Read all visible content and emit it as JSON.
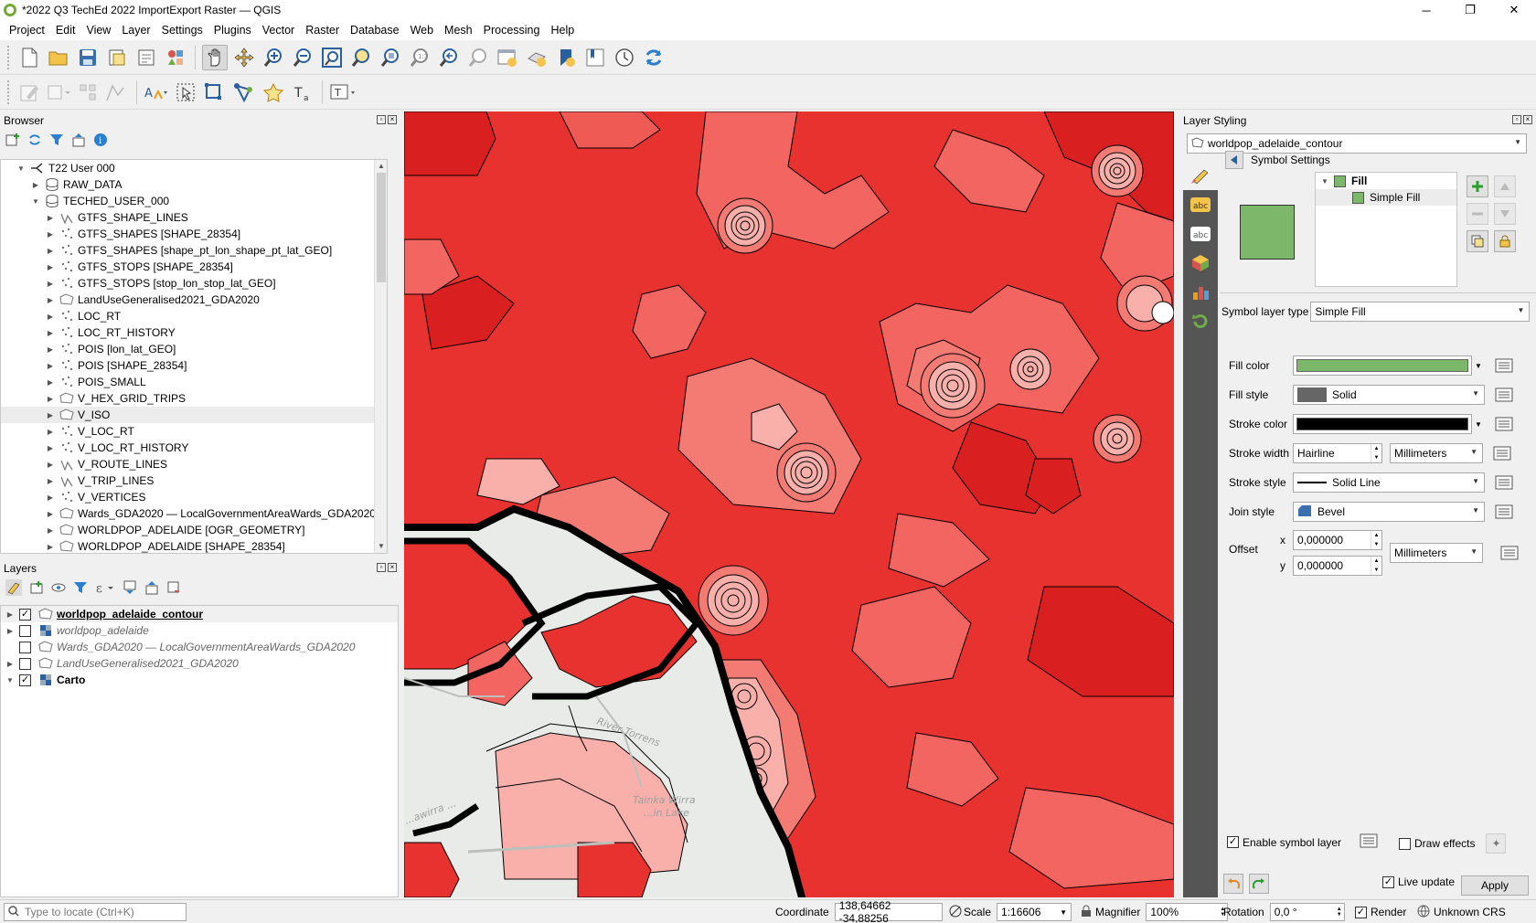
{
  "window": {
    "title": "*2022 Q3 TechEd 2022 ImportExport Raster — QGIS",
    "controls": [
      "─",
      "❐",
      "✕"
    ]
  },
  "menu": [
    "Project",
    "Edit",
    "View",
    "Layer",
    "Settings",
    "Plugins",
    "Vector",
    "Raster",
    "Database",
    "Web",
    "Mesh",
    "Processing",
    "Help"
  ],
  "browser": {
    "title": "Browser",
    "items": [
      {
        "label": "T22 User 000",
        "icon": "hana-connection-icon",
        "expanded": true
      },
      {
        "label": "RAW_DATA",
        "icon": "schema-icon",
        "expanded": false
      },
      {
        "label": "TECHED_USER_000",
        "icon": "schema-icon",
        "expanded": true
      },
      {
        "label": "GTFS_SHAPE_LINES",
        "icon": "line-layer-icon"
      },
      {
        "label": "GTFS_SHAPES [SHAPE_28354]",
        "icon": "point-layer-icon"
      },
      {
        "label": "GTFS_SHAPES [shape_pt_lon_shape_pt_lat_GEO]",
        "icon": "point-layer-icon"
      },
      {
        "label": "GTFS_STOPS [SHAPE_28354]",
        "icon": "point-layer-icon"
      },
      {
        "label": "GTFS_STOPS [stop_lon_stop_lat_GEO]",
        "icon": "point-layer-icon"
      },
      {
        "label": "LandUseGeneralised2021_GDA2020",
        "icon": "polygon-layer-icon"
      },
      {
        "label": "LOC_RT",
        "icon": "point-layer-icon"
      },
      {
        "label": "LOC_RT_HISTORY",
        "icon": "point-layer-icon"
      },
      {
        "label": "POIS [lon_lat_GEO]",
        "icon": "point-layer-icon"
      },
      {
        "label": "POIS [SHAPE_28354]",
        "icon": "point-layer-icon"
      },
      {
        "label": "POIS_SMALL",
        "icon": "point-layer-icon"
      },
      {
        "label": "V_HEX_GRID_TRIPS",
        "icon": "polygon-layer-icon"
      },
      {
        "label": "V_ISO",
        "icon": "polygon-layer-icon"
      },
      {
        "label": "V_LOC_RT",
        "icon": "point-layer-icon"
      },
      {
        "label": "V_LOC_RT_HISTORY",
        "icon": "point-layer-icon"
      },
      {
        "label": "V_ROUTE_LINES",
        "icon": "line-layer-icon"
      },
      {
        "label": "V_TRIP_LINES",
        "icon": "line-layer-icon"
      },
      {
        "label": "V_VERTICES",
        "icon": "point-layer-icon"
      },
      {
        "label": "Wards_GDA2020 — LocalGovernmentAreaWards_GDA2020",
        "icon": "polygon-layer-icon"
      },
      {
        "label": "WORLDPOP_ADELAIDE [OGR_GEOMETRY]",
        "icon": "polygon-layer-icon"
      },
      {
        "label": "WORLDPOP_ADELAIDE [SHAPE_28354]",
        "icon": "polygon-layer-icon"
      }
    ]
  },
  "layers": {
    "title": "Layers",
    "items": [
      {
        "label": "worldpop_adelaide_contour",
        "checked": true,
        "style": "bold",
        "icon": "polygon-layer-icon"
      },
      {
        "label": "worldpop_adelaide",
        "checked": false,
        "style": "italic",
        "icon": "raster-layer-icon"
      },
      {
        "label": "Wards_GDA2020 — LocalGovernmentAreaWards_GDA2020",
        "checked": false,
        "style": "italic",
        "icon": "polygon-layer-icon"
      },
      {
        "label": "LandUseGeneralised2021_GDA2020",
        "checked": false,
        "style": "italic",
        "icon": "polygon-layer-icon"
      },
      {
        "label": "Carto",
        "checked": true,
        "style": "bold-plain",
        "icon": "raster-layer-icon"
      }
    ]
  },
  "map": {
    "labels": [
      "River Torrens",
      "Tainka Wirra",
      "...in Lake",
      "...awirra ..."
    ]
  },
  "styling": {
    "title": "Layer Styling",
    "layer": "worldpop_adelaide_contour",
    "section": "Symbol Settings",
    "tree": {
      "root": "Fill",
      "child": "Simple Fill"
    },
    "fill_swatch": "#7db76a",
    "symbol_layer_type_label": "Symbol layer type",
    "symbol_layer_type": "Simple Fill",
    "fill_color_label": "Fill color",
    "fill_color": "#7db76a",
    "fill_style_label": "Fill style",
    "fill_style": "Solid",
    "stroke_color_label": "Stroke color",
    "stroke_color": "#000000",
    "stroke_width_label": "Stroke width",
    "stroke_width": "Hairline",
    "stroke_width_unit": "Millimeters",
    "stroke_style_label": "Stroke style",
    "stroke_style": "Solid Line",
    "join_style_label": "Join style",
    "join_style": "Bevel",
    "offset_label": "Offset",
    "offset_x_label": "x",
    "offset_x": "0,000000",
    "offset_y_label": "y",
    "offset_y": "0,000000",
    "offset_unit": "Millimeters",
    "enable_symbol_layer": "Enable symbol layer",
    "draw_effects": "Draw effects",
    "live_update": "Live update",
    "apply": "Apply"
  },
  "status": {
    "locate_placeholder": "Type to locate (Ctrl+K)",
    "coordinate_label": "Coordinate",
    "coordinate": "138,64662 -34,88256",
    "scale_label": "Scale",
    "scale": "1:16606",
    "magnifier_label": "Magnifier",
    "magnifier": "100%",
    "rotation_label": "Rotation",
    "rotation": "0,0 °",
    "render": "Render",
    "crs": "Unknown CRS"
  }
}
